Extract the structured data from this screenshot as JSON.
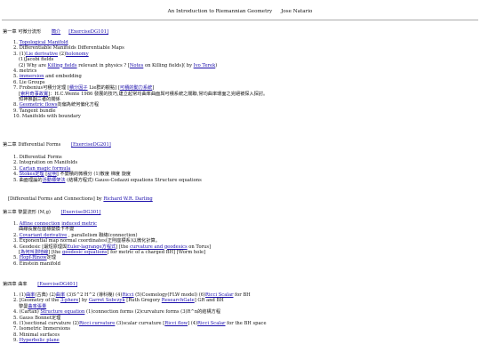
{
  "header": {
    "title": "An Introduction to Riemannian Geometry",
    "author": "Jose Natario"
  },
  "ch1": {
    "title": "第一章 可微分流形",
    "link1": "簡介",
    "link2": "[ExerciseDG101]",
    "items": [
      {
        "n": "1.",
        "parts": [
          {
            "t": "Topological Manifold",
            "l": true
          }
        ]
      },
      {
        "n": "2.",
        "parts": [
          {
            "t": "Differentiable Manifolds     Differentiable Maps"
          }
        ]
      },
      {
        "n": "3.",
        "parts": [
          {
            "t": "(1)"
          },
          {
            "t": "Lie derivative",
            "l": true
          },
          {
            "t": " (2)"
          },
          {
            "t": "holonomy",
            "l": true
          }
        ]
      },
      {
        "sub": true,
        "parts": [
          {
            "t": "(1)Jacobi fields"
          }
        ]
      },
      {
        "sub": true,
        "parts": [
          {
            "t": "(2) Why are "
          },
          {
            "t": "Killing fields",
            "l": true
          },
          {
            "t": " relevant in physics ? ["
          },
          {
            "t": "Notes",
            "l": true
          },
          {
            "t": " on Killing fields]( by "
          },
          {
            "t": "Ivo Terek",
            "l": true
          },
          {
            "t": ")"
          }
        ]
      },
      {
        "n": "4.",
        "parts": [
          {
            "t": "metrics"
          }
        ]
      },
      {
        "n": "5.",
        "parts": [
          {
            "t": "immersion",
            "l": true
          },
          {
            "t": " and embedding"
          }
        ]
      },
      {
        "n": "6.",
        "parts": [
          {
            "t": "Lie Groups"
          }
        ]
      },
      {
        "n": "7.",
        "parts": [
          {
            "t": "Frobenius可積分定理 ["
          },
          {
            "t": "積分因子",
            "l": true
          },
          {
            "t": " Lie群的觀點] ["
          },
          {
            "t": "可積的動力系統",
            "l": true
          },
          {
            "t": "]"
          }
        ]
      },
      {
        "sub": true,
        "parts": [
          {
            "t": "["
          },
          {
            "t": "索利奇事故實",
            "l": true
          },
          {
            "t": "]：H.C.Wente 1986 發展的技巧,建立起常均曲率曲面與可積系統之關聯,常均曲率環面之完絕被探入探討。"
          }
        ]
      },
      {
        "sub": true,
        "parts": [
          {
            "t": "知神推翻三者的關係"
          }
        ]
      },
      {
        "n": "8.",
        "parts": [
          {
            "t": "Geometric flows",
            "l": true
          },
          {
            "t": "向偏為統何偏化方程"
          }
        ]
      },
      {
        "n": "9.",
        "parts": [
          {
            "t": "Tangent bundle"
          }
        ]
      },
      {
        "n": "10.",
        "parts": [
          {
            "t": "Manifolds with boundary"
          }
        ]
      }
    ]
  },
  "ch2": {
    "title": "第二章 Differential Forms",
    "link1": "[ExerciseDG201]",
    "items": [
      {
        "n": "1.",
        "parts": [
          {
            "t": "Differential Forms"
          }
        ]
      },
      {
        "n": "2.",
        "parts": [
          {
            "t": "Integration on Manifolds"
          }
        ]
      },
      {
        "n": "3.",
        "parts": [
          {
            "t": "Cartan magic formula",
            "l": true
          }
        ]
      },
      {
        "n": "4.",
        "parts": [
          {
            "t": "Stokes定理",
            "l": true
          },
          {
            "t": "  ["
          },
          {
            "t": "証明",
            "l": true
          },
          {
            "t": "] 不變積的微積分 (1)散度 梯度 旋度"
          }
        ]
      },
      {
        "n": "5.",
        "parts": [
          {
            "t": "曲面理論的"
          },
          {
            "t": "活動標架法",
            "l": true
          },
          {
            "t": " (結構方程式) Gauss-Codazzi equations  Structure equations"
          }
        ]
      }
    ],
    "note_a": "[Differential Forms and Connections] by ",
    "note_link": "Richard W.R. Darling"
  },
  "ch3": {
    "title": "第三章 黎曼流形 (M,g)",
    "link1": "[ExerciseDG301]",
    "items": [
      {
        "n": "1.",
        "parts": [
          {
            "t": "Affine connection",
            "l": true
          },
          {
            "t": "    "
          },
          {
            "t": "induced metric",
            "l": true
          }
        ]
      },
      {
        "sub": true,
        "parts": [
          {
            "t": "曲線長度在座標變換下不變"
          }
        ]
      },
      {
        "n": "2.",
        "parts": [
          {
            "t": "Covariant derivative",
            "l": true
          },
          {
            "t": " , parallelism 聯絡(connection)"
          }
        ]
      },
      {
        "n": "3.",
        "parts": [
          {
            "t": "Exponential map      normal coordinates(正則座標系)以微化計算。"
          }
        ]
      },
      {
        "n": "4.",
        "parts": [
          {
            "t": "Geodesic    [最短原理與"
          },
          {
            "t": "Euler-lagrange方程式",
            "l": true
          },
          {
            "t": "] [the "
          },
          {
            "t": "curvature and geodesics",
            "l": true
          },
          {
            "t": " on Torus]"
          }
        ]
      },
      {
        "sub": true,
        "parts": [
          {
            "t": "["
          },
          {
            "t": "為何叫測地線",
            "l": true
          },
          {
            "t": "]   [the "
          },
          {
            "t": "geodesic equations",
            "l": true
          },
          {
            "t": "] for metric of a charged BH] [Worm hole]"
          }
        ]
      },
      {
        "n": "5.",
        "parts": [
          {
            "t": "Hopf-Rinow",
            "l": true
          },
          {
            "t": "定理"
          }
        ]
      },
      {
        "n": "6.",
        "parts": [
          {
            "t": "Einstein manifold"
          }
        ]
      }
    ]
  },
  "ch4": {
    "title": "第四章 曲率",
    "link1": "[ExerciseDG401]",
    "items": [
      {
        "n": "1.",
        "parts": [
          {
            "t": "(1)"
          },
          {
            "t": "曲率",
            "l": true
          },
          {
            "t": "(古典) (2)"
          },
          {
            "t": "曲率",
            "l": true
          },
          {
            "t": " (3)S^2 H^2 (導科幾) (4)"
          },
          {
            "t": "Ricci",
            "l": true
          },
          {
            "t": "  (5)Cosmology(FLW model)  (6)"
          },
          {
            "t": "Ricci Scalar",
            "l": true
          },
          {
            "t": " for BH"
          }
        ]
      },
      {
        "n": "2.",
        "parts": [
          {
            "t": "[Geometry of the "
          },
          {
            "t": "3-phere",
            "l": true
          },
          {
            "t": "] by "
          },
          {
            "t": "Garret Sobczyk",
            "l": true
          },
          {
            "t": "    [Ruth Gregory "
          },
          {
            "t": "ResearchGate",
            "l": true
          },
          {
            "t": "] GR and BH"
          }
        ]
      },
      {
        "sub": true,
        "parts": [
          {
            "t": "黎曼"
          },
          {
            "t": "曲率張量",
            "l": true
          }
        ]
      },
      {
        "n": "4.",
        "parts": [
          {
            "t": "(Cartan) "
          },
          {
            "t": "Structure equation",
            "l": true
          },
          {
            "t": " (1)connection forms (2)curvature forms (3)R^n的結構方程"
          }
        ]
      },
      {
        "n": "5.",
        "parts": [
          {
            "t": "Gauss Bonnet定理"
          }
        ]
      },
      {
        "n": "6.",
        "parts": [
          {
            "t": "(1)sectional curvature (2)"
          },
          {
            "t": "Ricci curvature",
            "l": true
          },
          {
            "t": " (3)scalar curvature    ["
          },
          {
            "t": "Ricci flow",
            "l": true
          },
          {
            "t": "]  (4)"
          },
          {
            "t": "Ricci Scalar",
            "l": true
          },
          {
            "t": " for the BH space"
          }
        ]
      },
      {
        "n": "7.",
        "parts": [
          {
            "t": "Isometric Immersions"
          }
        ]
      },
      {
        "n": "8.",
        "parts": [
          {
            "t": "Minimal surfaces"
          }
        ]
      },
      {
        "n": "9.",
        "parts": [
          {
            "t": "Hyperbolic plane",
            "l": true
          }
        ]
      }
    ]
  }
}
